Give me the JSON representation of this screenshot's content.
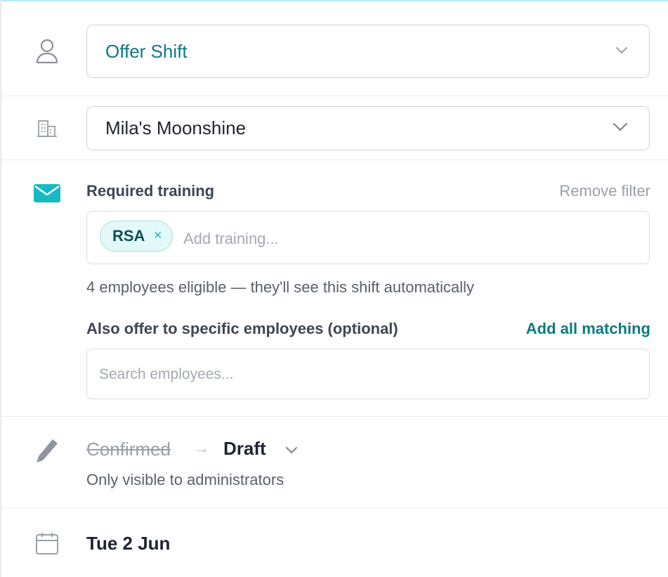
{
  "role": {
    "icon": "person-icon",
    "value": "Offer Shift"
  },
  "venue": {
    "icon": "building-icon",
    "value": "Mila's Moonshine"
  },
  "training": {
    "icon": "envelope-icon",
    "label": "Required training",
    "remove_filter": "Remove filter",
    "chip": {
      "label": "RSA",
      "remove": "×"
    },
    "placeholder": "Add training...",
    "eligible_text": "4 employees eligible — they'll see this shift automatically",
    "also_offer_label": "Also offer to specific employees (optional)",
    "add_all_matching": "Add all matching",
    "search_placeholder": "Search employees..."
  },
  "status": {
    "icon": "pencil-icon",
    "old": "Confirmed",
    "arrow": "→",
    "new": "Draft",
    "note": "Only visible to administrators"
  },
  "date": {
    "icon": "calendar-icon",
    "value": "Tue 2 Jun"
  },
  "colors": {
    "accent": "#18b9c4",
    "teal_text": "#0d7a80",
    "muted": "#9aa0a8",
    "border": "#cfd3da"
  }
}
